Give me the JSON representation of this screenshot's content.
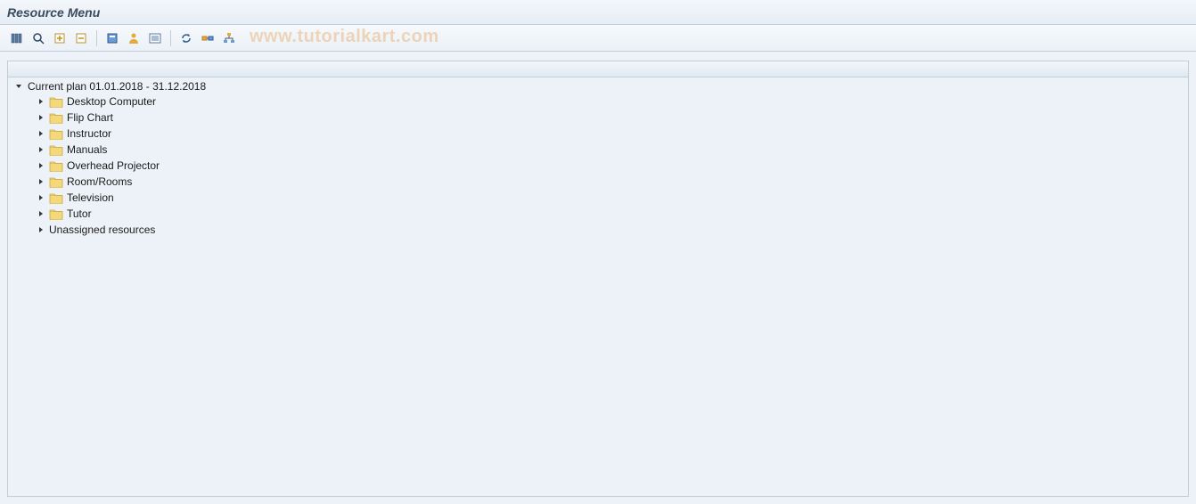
{
  "title": "Resource Menu",
  "watermark": "www.tutorialkart.com",
  "toolbar": {
    "buttons": [
      {
        "name": "columns-icon"
      },
      {
        "name": "search-icon"
      },
      {
        "name": "create-icon"
      },
      {
        "name": "collapse-icon"
      }
    ],
    "group2": [
      {
        "name": "object-icon"
      },
      {
        "name": "person-icon"
      },
      {
        "name": "list-icon"
      }
    ],
    "group3": [
      {
        "name": "refresh-icon"
      },
      {
        "name": "relation-icon"
      },
      {
        "name": "hierarchy-icon"
      }
    ]
  },
  "tree": {
    "root": {
      "label": "Current plan 01.01.2018 - 31.12.2018"
    },
    "items": [
      {
        "label": "Desktop Computer",
        "hasFolder": true
      },
      {
        "label": "Flip Chart",
        "hasFolder": true
      },
      {
        "label": "Instructor",
        "hasFolder": true
      },
      {
        "label": "Manuals",
        "hasFolder": true
      },
      {
        "label": "Overhead Projector",
        "hasFolder": true
      },
      {
        "label": "Room/Rooms",
        "hasFolder": true
      },
      {
        "label": "Television",
        "hasFolder": true
      },
      {
        "label": "Tutor",
        "hasFolder": true
      },
      {
        "label": "Unassigned resources",
        "hasFolder": false
      }
    ]
  }
}
